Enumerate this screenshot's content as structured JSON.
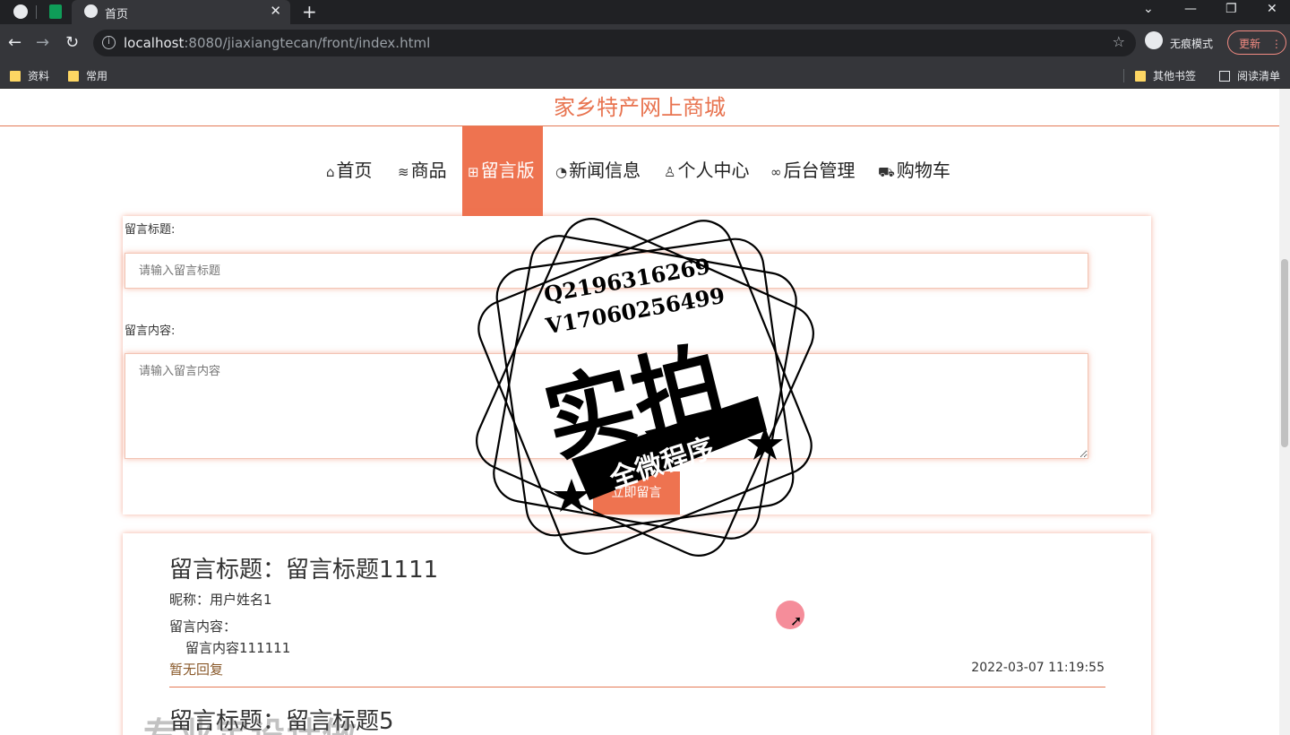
{
  "browser": {
    "tab_title": "首页",
    "tab_close": "✕",
    "new_tab": "+",
    "window_controls": [
      "⌄",
      "—",
      "❐",
      "✕"
    ],
    "url_host": "localhost",
    "url_rest": ":8080/jiaxiangtecan/front/index.html",
    "incognito_label": "无痕模式",
    "update_label": "更新",
    "bookmarks": [
      "资料",
      "常用"
    ],
    "bookmarks_right": [
      "其他书签",
      "阅读清单"
    ]
  },
  "site": {
    "title": "家乡特产网上商城",
    "nav": [
      {
        "icon": "⌂",
        "label": "首页"
      },
      {
        "icon": "≋",
        "label": "商品"
      },
      {
        "icon": "⊞",
        "label": "留言版",
        "active": true
      },
      {
        "icon": "◔",
        "label": "新闻信息"
      },
      {
        "icon": "♙",
        "label": "个人中心"
      },
      {
        "icon": "∞",
        "label": "后台管理"
      },
      {
        "icon": "⛟",
        "label": "购物车"
      }
    ]
  },
  "form": {
    "title_label": "留言标题:",
    "title_placeholder": "请输入留言标题",
    "content_label": "留言内容:",
    "content_placeholder": "请输入留言内容",
    "submit_label": "立即留言"
  },
  "messages": [
    {
      "title": "留言标题：留言标题1111",
      "nickname": "昵称：用户姓名1",
      "content_label": "留言内容：",
      "content": "留言内容111111",
      "reply": "暂无回复",
      "time": "2022-03-07 11:19:55"
    },
    {
      "title": "留言标题：留言标题5"
    }
  ],
  "overlay": {
    "stamp_contact_1": "Q2196316269",
    "stamp_contact_2": "V17060256499",
    "stamp_main": "实拍",
    "stamp_banner": "全微程序",
    "bottom_watermark": "专业定设计做"
  }
}
